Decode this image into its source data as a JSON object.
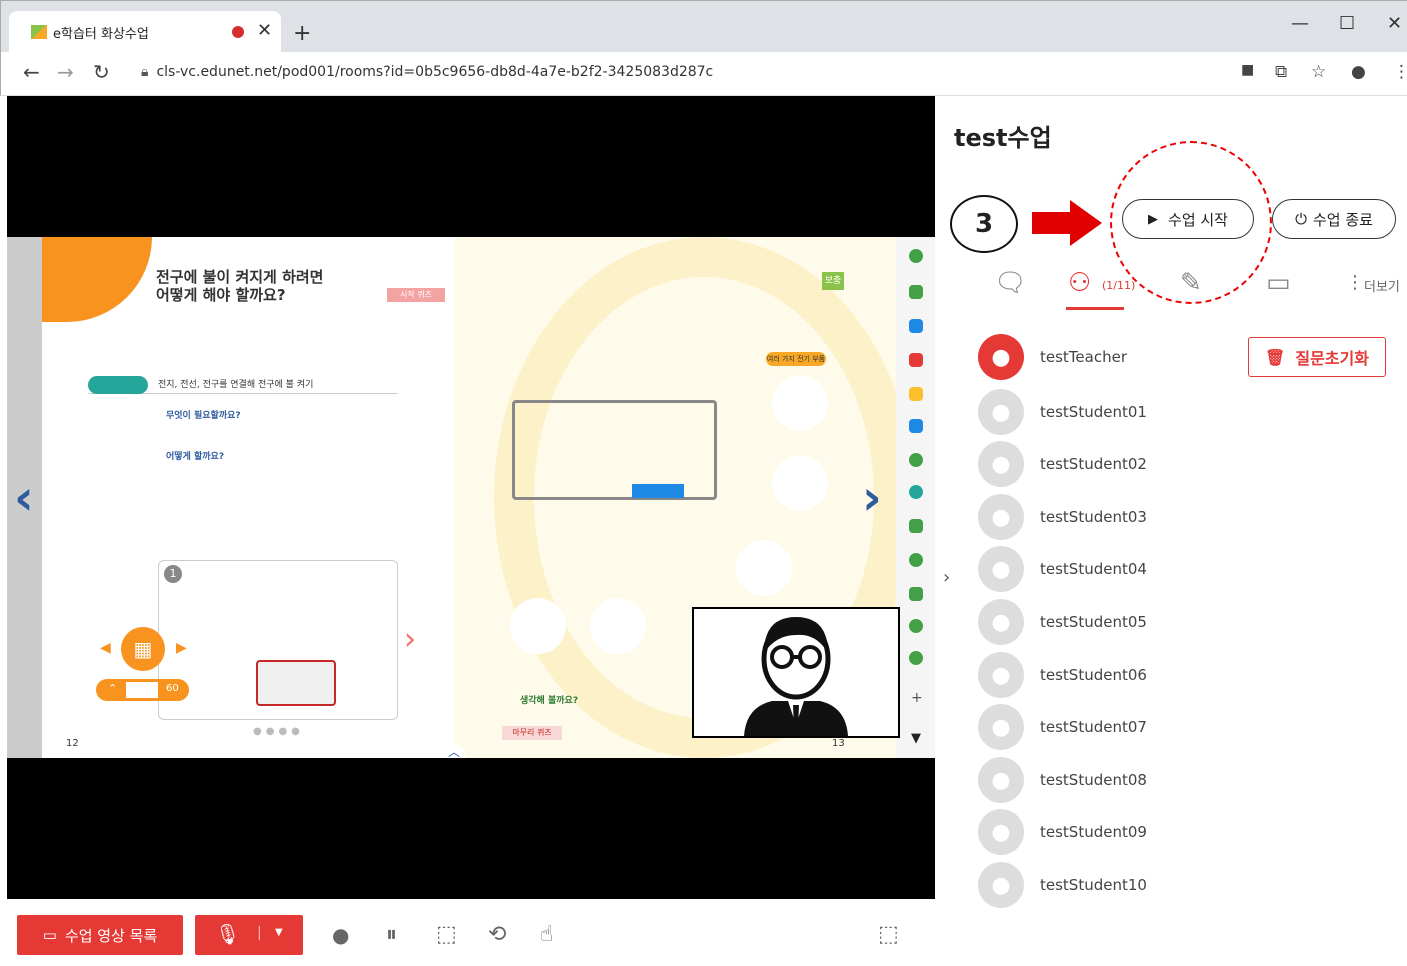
{
  "browser": {
    "tab_title": "e학습터 화상수업",
    "url": "cls-vc.edunet.net/pod001/rooms?id=0b5c9656-db8d-4a7e-b2f2-3425083d287c"
  },
  "book": {
    "left_title_line1": "전구에 불이 켜지게 하려면",
    "left_title_line2": "어떻게 해야 할까요?",
    "quiz_label": "시작 퀴즈",
    "activity_label": "전지, 전선, 전구를 연결해 전구에 불 켜기",
    "needed_label": "무엇이 필요할까요?",
    "howto_label": "어떻게 할까요?",
    "zoom_value": "60",
    "page_left": "12",
    "page_right": "13",
    "right_tag": "보충",
    "right_subtitle": "여러 가지 전기 부품",
    "think_label": "생각해 볼까요?",
    "final_quiz": "마무리 퀴즈",
    "step1": "1"
  },
  "panel": {
    "title": "test수업",
    "start_button": "수업 시작",
    "end_button": "수업 종료",
    "annotation_number": "3",
    "participants_count": "(1/11)",
    "more_label": "더보기",
    "reset_button": "질문초기화",
    "members": [
      "testTeacher",
      "testStudent01",
      "testStudent02",
      "testStudent03",
      "testStudent04",
      "testStudent05",
      "testStudent06",
      "testStudent07",
      "testStudent08",
      "testStudent09",
      "testStudent10"
    ]
  },
  "toolbar": {
    "video_list_button": "수업 영상 목록"
  },
  "colors": {
    "accent_red": "#e53935",
    "book_orange": "#f7931e",
    "nav_blue": "#2e5c9e"
  }
}
